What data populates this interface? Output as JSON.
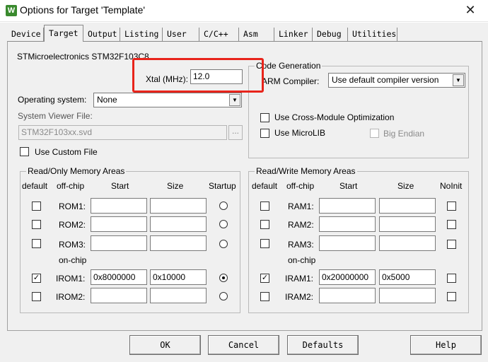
{
  "window": {
    "title": "Options for Target 'Template'"
  },
  "tabs": [
    "Device",
    "Target",
    "Output",
    "Listing",
    "User",
    "C/C++",
    "Asm",
    "Linker",
    "Debug",
    "Utilities"
  ],
  "device_label": "STMicroelectronics STM32F103C8",
  "xtal": {
    "label": "Xtal (MHz):",
    "value": "12.0"
  },
  "os": {
    "label": "Operating system:",
    "value": "None"
  },
  "svd": {
    "label": "System Viewer File:",
    "value": "STM32F103xx.svd",
    "browse": "..."
  },
  "custom_file": {
    "label": "Use Custom File",
    "checked": false
  },
  "code_gen": {
    "legend": "Code Generation",
    "compiler_label": "ARM Compiler:",
    "compiler_value": "Use default compiler version",
    "cross_module": "Use Cross-Module Optimization",
    "microlib": "Use MicroLIB",
    "big_endian": "Big Endian"
  },
  "ro_memory": {
    "legend": "Read/Only Memory Areas",
    "headers": {
      "default": "default",
      "offchip": "off-chip",
      "start": "Start",
      "size": "Size",
      "startup": "Startup"
    },
    "onchip_label": "on-chip",
    "rows": [
      {
        "name": "ROM1:",
        "start": "",
        "size": "",
        "default": false,
        "startup": false
      },
      {
        "name": "ROM2:",
        "start": "",
        "size": "",
        "default": false,
        "startup": false
      },
      {
        "name": "ROM3:",
        "start": "",
        "size": "",
        "default": false,
        "startup": false
      },
      {
        "name": "IROM1:",
        "start": "0x8000000",
        "size": "0x10000",
        "default": true,
        "startup": true
      },
      {
        "name": "IROM2:",
        "start": "",
        "size": "",
        "default": false,
        "startup": false
      }
    ]
  },
  "rw_memory": {
    "legend": "Read/Write Memory Areas",
    "headers": {
      "default": "default",
      "offchip": "off-chip",
      "start": "Start",
      "size": "Size",
      "noinit": "NoInit"
    },
    "onchip_label": "on-chip",
    "rows": [
      {
        "name": "RAM1:",
        "start": "",
        "size": "",
        "default": false,
        "noinit": false
      },
      {
        "name": "RAM2:",
        "start": "",
        "size": "",
        "default": false,
        "noinit": false
      },
      {
        "name": "RAM3:",
        "start": "",
        "size": "",
        "default": false,
        "noinit": false
      },
      {
        "name": "IRAM1:",
        "start": "0x20000000",
        "size": "0x5000",
        "default": true,
        "noinit": false
      },
      {
        "name": "IRAM2:",
        "start": "",
        "size": "",
        "default": false,
        "noinit": false
      }
    ]
  },
  "buttons": {
    "ok": "OK",
    "cancel": "Cancel",
    "defaults": "Defaults",
    "help": "Help"
  },
  "colors": {
    "highlight": "#e8241b",
    "app_icon": "#3a8a2e"
  }
}
